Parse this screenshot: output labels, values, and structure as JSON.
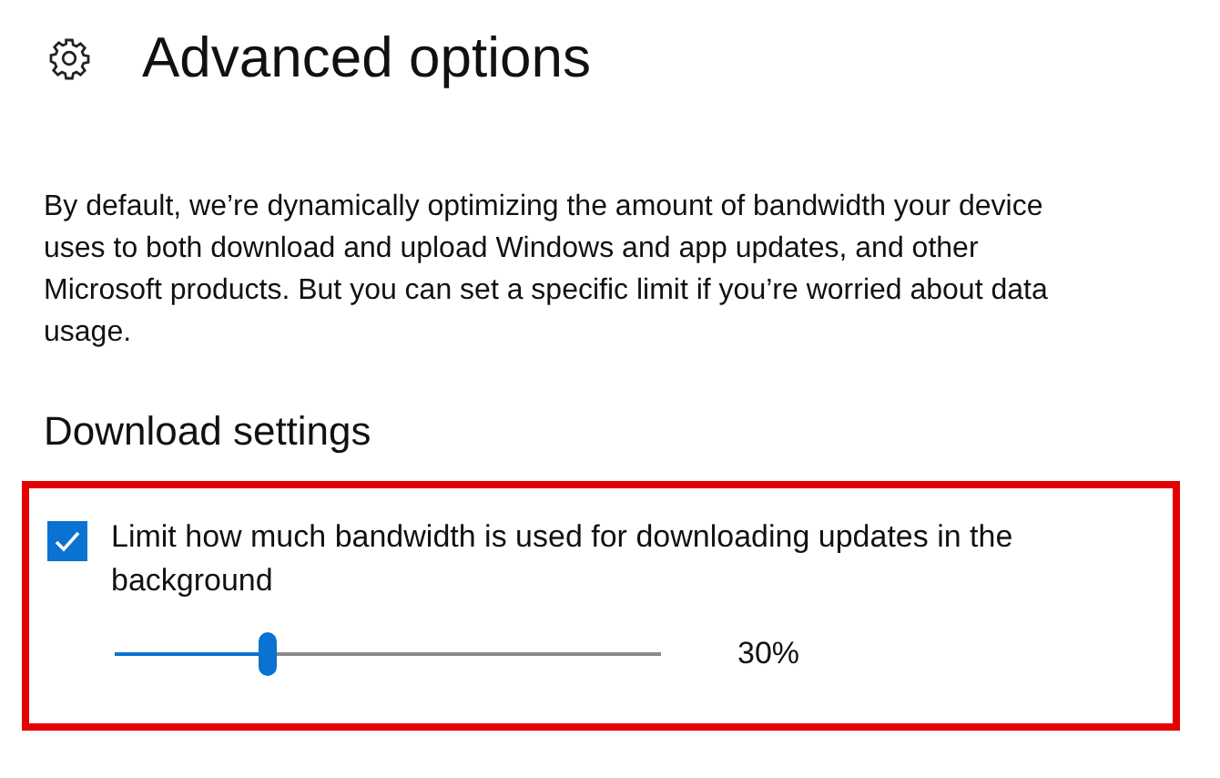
{
  "page": {
    "title": "Advanced options"
  },
  "description": "By default, we’re dynamically optimizing the amount of bandwidth your device uses to both download and upload Windows and app updates, and other Microsoft products. But you can set a specific limit if you’re worried about data usage.",
  "section": {
    "heading": "Download settings"
  },
  "limit_option": {
    "label": "Limit how much bandwidth is used for downloading updates in the background",
    "checked": true
  },
  "bandwidth_slider": {
    "level": 0.28,
    "reading": "30%"
  }
}
